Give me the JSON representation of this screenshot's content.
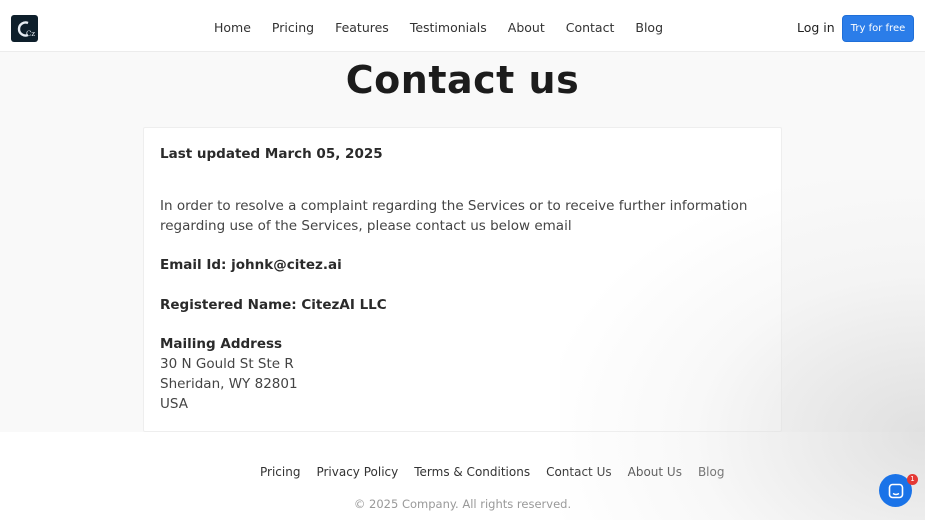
{
  "brand": {
    "logo_text": "Cz"
  },
  "nav": {
    "items": [
      {
        "label": "Home"
      },
      {
        "label": "Pricing"
      },
      {
        "label": "Features"
      },
      {
        "label": "Testimonials"
      },
      {
        "label": "About"
      },
      {
        "label": "Contact"
      },
      {
        "label": "Blog"
      }
    ],
    "login_label": "Log in",
    "cta_label": "Try for free"
  },
  "main": {
    "title": "Contact us",
    "last_updated": "Last updated March 05, 2025",
    "intro": "In order to resolve a complaint regarding the Services or to receive further information regarding use of the Services, please contact us below email",
    "email": "Email Id: johnk@citez.ai",
    "registered_name": "Registered Name: CitezAI LLC",
    "address_heading": "Mailing Address",
    "address_lines": [
      "30 N Gould St Ste R",
      "Sheridan, WY 82801",
      "USA"
    ]
  },
  "footer": {
    "links": [
      {
        "label": "Pricing"
      },
      {
        "label": "Privacy Policy"
      },
      {
        "label": "Terms & Conditions"
      },
      {
        "label": "Contact Us"
      },
      {
        "label": "About Us"
      },
      {
        "label": "Blog"
      }
    ],
    "copyright": "© 2025 Company. All rights reserved."
  },
  "chat": {
    "icon": "chat-icon",
    "badge_count": "1"
  },
  "colors": {
    "accent": "#2b7de9",
    "logo_bg": "#0e1f2b",
    "badge": "#e53935"
  }
}
